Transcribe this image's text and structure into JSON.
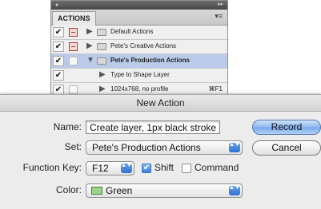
{
  "panel": {
    "tab_label": "ACTIONS",
    "menu_glyph": "▾≡",
    "collapse_glyph": "▸▸",
    "close_glyph": "●",
    "rows": [
      {
        "label": "Default Actions",
        "checked": "✔",
        "twisty": "▶",
        "shortcut": ""
      },
      {
        "label": "Pete's Creative Actions",
        "checked": "✔",
        "twisty": "▶",
        "shortcut": ""
      },
      {
        "label": "Pete's Production Actions",
        "checked": "✔",
        "twisty": "▼",
        "shortcut": ""
      },
      {
        "label": "Type to Shape Layer",
        "checked": "✔",
        "twisty": "▶",
        "shortcut": ""
      },
      {
        "label": "1024x768, no profile",
        "checked": "✔",
        "twisty": "▶",
        "shortcut": "⌘F1"
      }
    ]
  },
  "dialog": {
    "title": "New Action",
    "name_label": "Name:",
    "name_value": "Create layer, 1px black stroke",
    "set_label": "Set:",
    "set_value": "Pete's Production Actions",
    "function_key_label": "Function Key:",
    "function_key_value": "F12",
    "shift_label": "Shift",
    "shift_checked": "✔",
    "command_label": "Command",
    "color_label": "Color:",
    "color_value": "Green",
    "record_label": "Record",
    "cancel_label": "Cancel",
    "popup_arrows": "▲▼",
    "swatch_color": "#9ad486"
  }
}
